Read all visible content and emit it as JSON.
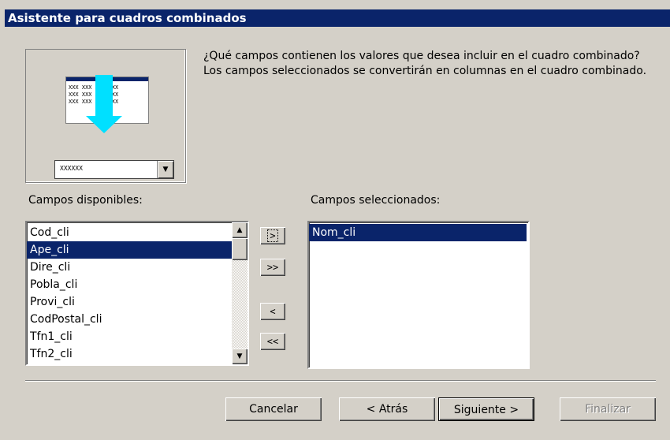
{
  "window": {
    "title": "Asistente para cuadros combinados"
  },
  "illustration": {
    "cells": [
      "XXX XXX XXX XXX",
      "XXX XXX XXX XXX",
      "XXX XXX XXX XXX"
    ],
    "combo_text": "XXXXXX",
    "combo_arrow": "▼"
  },
  "description": "¿Qué campos contienen los valores que desea incluir en el cuadro combinado? Los campos seleccionados se convertirán en columnas en el cuadro combinado.",
  "available": {
    "label": "Campos disponibles:",
    "items": [
      {
        "text": "Cod_cli",
        "selected": false
      },
      {
        "text": "Ape_cli",
        "selected": true
      },
      {
        "text": "Dire_cli",
        "selected": false
      },
      {
        "text": "Pobla_cli",
        "selected": false
      },
      {
        "text": "Provi_cli",
        "selected": false
      },
      {
        "text": "CodPostal_cli",
        "selected": false
      },
      {
        "text": "Tfn1_cli",
        "selected": false
      },
      {
        "text": "Tfn2_cli",
        "selected": false
      }
    ],
    "scroll_up": "▲",
    "scroll_down": "▼"
  },
  "selected_fields": {
    "label": "Campos seleccionados:",
    "items": [
      {
        "text": "Nom_cli",
        "selected": true
      }
    ]
  },
  "move_buttons": {
    "add_one": ">",
    "add_all": ">>",
    "remove_one": "<",
    "remove_all": "<<"
  },
  "buttons": {
    "cancel": "Cancelar",
    "back": "< Atrás",
    "next": "Siguiente >",
    "finish": "Finalizar"
  },
  "colors": {
    "titlebar": "#0a246a",
    "selection": "#0a246a",
    "face": "#d4d0c8",
    "arrow": "#00e0ff"
  }
}
